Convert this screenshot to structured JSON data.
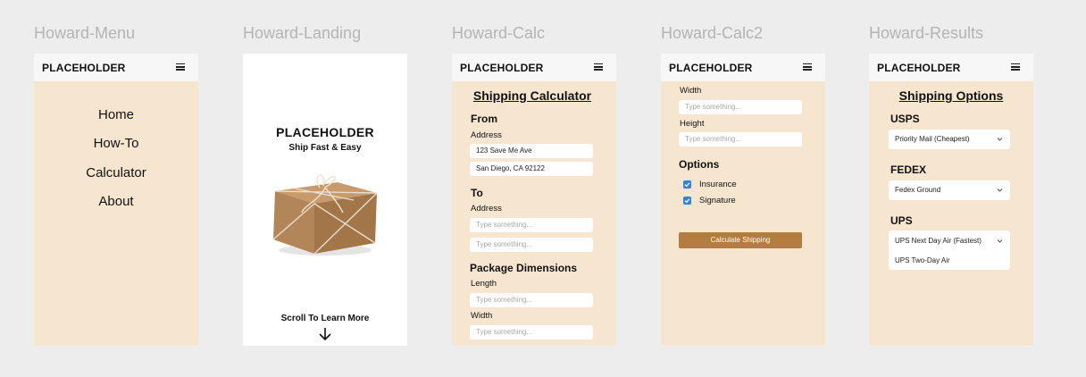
{
  "brand": "PLACEHOLDER",
  "colors": {
    "canvas": "#ededed",
    "frame_bg": "#f7e6cf",
    "button": "#b47c3f",
    "checkbox": "#2b83e3"
  },
  "frames": {
    "menu": {
      "title": "Howard-Menu",
      "items": [
        "Home",
        "How-To",
        "Calculator",
        "About"
      ]
    },
    "landing": {
      "title": "Howard-Landing",
      "headline": "PLACEHOLDER",
      "tagline": "Ship Fast & Easy",
      "scroll_text": "Scroll To Learn More"
    },
    "calc": {
      "title": "Howard-Calc",
      "heading": "Shipping Calculator",
      "from_label": "From",
      "from_address_label": "Address",
      "from_line1": "123 Save Me Ave",
      "from_line2": "San Diego, CA 92122",
      "to_label": "To",
      "to_address_label": "Address",
      "to_placeholder": "Type something...",
      "package_label": "Package Dimensions",
      "length_label": "Length",
      "width_label": "Width",
      "placeholder": "Type something..."
    },
    "calc2": {
      "title": "Howard-Calc2",
      "width_label": "Width",
      "height_label": "Height",
      "placeholder": "Type something...",
      "options_label": "Options",
      "insurance_label": "Insurance",
      "signature_label": "Signature",
      "insurance_checked": true,
      "signature_checked": true,
      "button_label": "Calculate Shipping"
    },
    "results": {
      "title": "Howard-Results",
      "heading": "Shipping Options",
      "usps_label": "USPS",
      "usps_selected": "Priority Mail (Cheapest)",
      "fedex_label": "FEDEX",
      "fedex_selected": "Fedex Ground",
      "ups_label": "UPS",
      "ups_selected": "UPS Next Day Air (Fastest)",
      "ups_option_2": "UPS Two-Day Air"
    }
  }
}
